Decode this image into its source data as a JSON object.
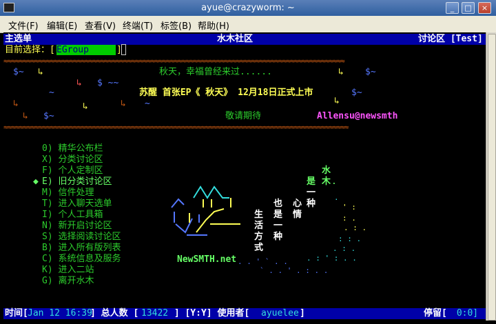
{
  "window": {
    "title": "ayue@crazyworm: ~"
  },
  "menu": [
    "文件(F)",
    "编辑(E)",
    "查看(V)",
    "终端(T)",
    "标签(B)",
    "帮助(H)"
  ],
  "header": {
    "left": "主选单",
    "center": "水木社区",
    "right": "讨论区 [Test]"
  },
  "prompt": {
    "label": "目前选择：[",
    "value": "EGroup",
    "close": "]"
  },
  "banner": {
    "line1": "秋天，幸福曾经来过......",
    "line2": "苏醒 首张EP《 秋天》 12月18日正式上市",
    "line3": "敬请期待",
    "author": "Allensu@newsmth"
  },
  "menu_items": [
    "0) 精华公布栏",
    "X) 分类讨论区",
    "F) 个人定制区",
    "E) 旧分类讨论区",
    "M) 信件处理",
    "T) 进入聊天选单",
    "I) 个人工具箱",
    "N) 新开启讨论区",
    "S) 选择阅读讨论区",
    "B) 进入所有版列表",
    "C) 系统信息及服务",
    "K) 进入二站",
    "G) 离开水木"
  ],
  "selected_marker": "◆",
  "art": {
    "col1": [
      "水",
      "木",
      "一",
      "种"
    ],
    "col1_pre": [
      "是",
      "."
    ],
    "col2": [
      "心",
      "情"
    ],
    "col3": [
      "也",
      "是",
      "一",
      "种"
    ],
    "col4": [
      "生",
      "活",
      "方",
      "式"
    ],
    "site": "NewSMTH.net"
  },
  "status": {
    "time_label": "时间[",
    "time_value": "Jan 12 16:39",
    "users_label": "] 总人数 [",
    "users_value": "13422",
    "mode_label": " ] [Y:Y] 使用者[",
    "user_value": "ayuelee",
    "user_close": "]",
    "stay_label": "停留[",
    "stay_value": " 0:0]"
  },
  "colors": {
    "selection_bg": "#00cc00",
    "status_bar": "#0000a8"
  }
}
